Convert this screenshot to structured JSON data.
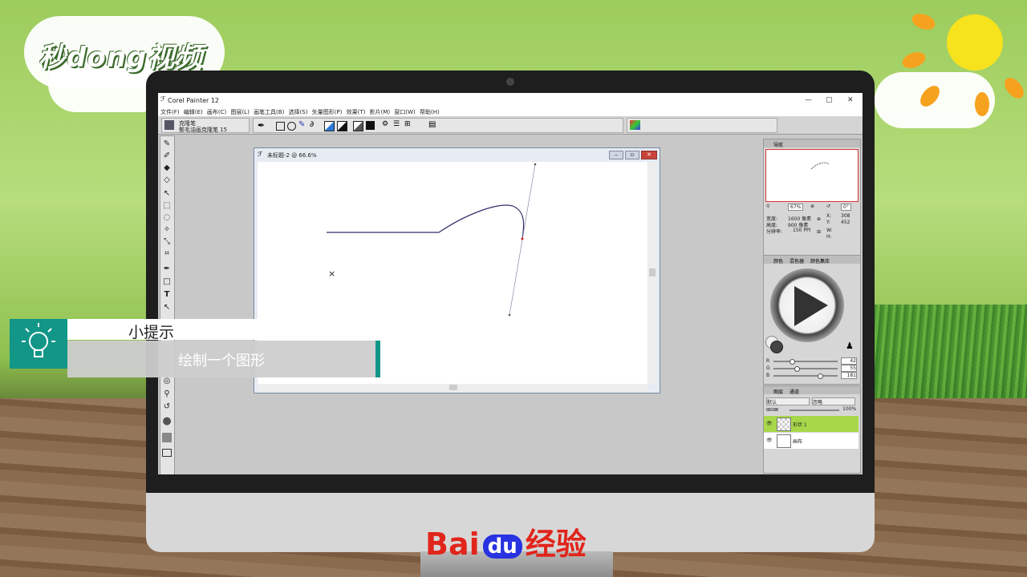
{
  "watermark": {
    "logo_text": "秒dong视频"
  },
  "app": {
    "title": "Corel Painter 12",
    "window_controls": {
      "minimize": "—",
      "maximize": "▢",
      "close": "✕"
    },
    "menu": [
      "文件(F)",
      "编辑(E)",
      "画布(C)",
      "图层(L)",
      "画笔工具(B)",
      "选择(S)",
      "矢量图形(P)",
      "效果(T)",
      "影片(M)",
      "窗口(W)",
      "帮助(H)"
    ],
    "brush": {
      "category": "克隆笔",
      "variant": "鬃毛油画克隆笔 15"
    },
    "document": {
      "title": "未标题-2 @ 66.6%"
    }
  },
  "navigator": {
    "tab": "导航",
    "zoom": "67%",
    "angle": "0°",
    "width_label": "宽度:",
    "width_value": "1600 像素",
    "height_label": "高度:",
    "height_value": "900 像素",
    "res_label": "分辨率:",
    "res_value": "150 PPI",
    "x_label": "X:",
    "x_value": "308",
    "y_label": "Y:",
    "y_value": "452",
    "w_label": "W:",
    "h_label": "H:"
  },
  "color_panel": {
    "tabs": [
      "颜色",
      "混色器",
      "颜色集库"
    ],
    "r_label": "R",
    "r_value": "42",
    "g_label": "G",
    "g_value": "55",
    "b_label": "B",
    "b_value": "181",
    "accent": "#2a37b5"
  },
  "layers_panel": {
    "tabs": [
      "图层",
      "通道"
    ],
    "composite": "默认",
    "method": "忽略",
    "opacity": "100%",
    "layers": [
      {
        "name": "形状 1",
        "selected": true
      },
      {
        "name": "画布",
        "selected": false
      }
    ]
  },
  "tip": {
    "title": "小提示",
    "text": "绘制一个图形",
    "accent": "#129688"
  },
  "footer": {
    "brand": "Bai",
    "brand_du": "du",
    "brand_cn": "经验"
  }
}
